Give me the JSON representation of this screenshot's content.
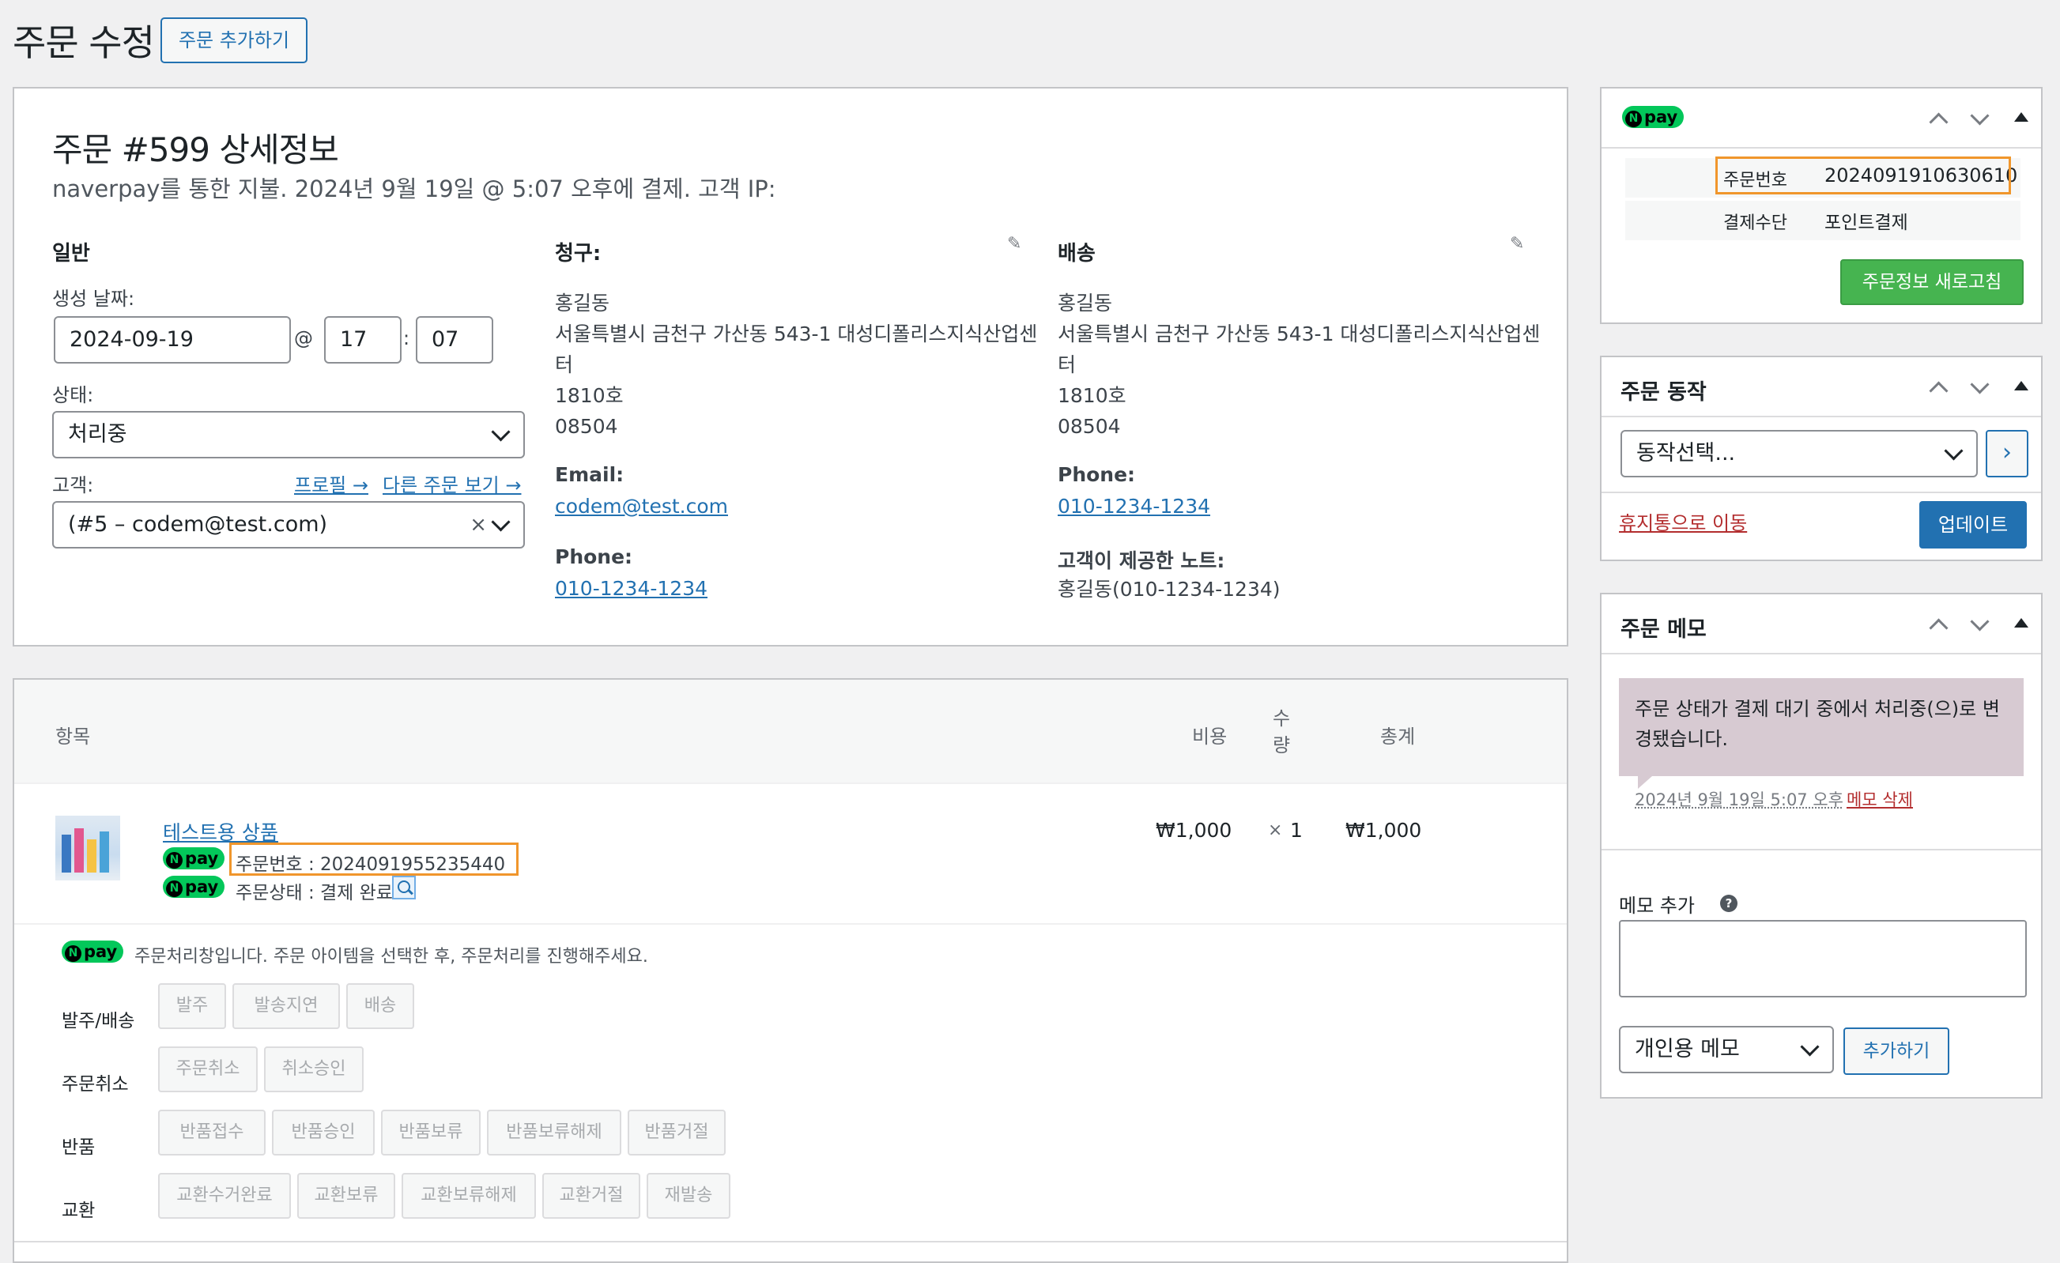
{
  "page": {
    "title": "주문 수정",
    "add_order": "주문 추가하기"
  },
  "order": {
    "heading": "주문 #599 상세정보",
    "subtitle": "naverpay를 통한 지불. 2024년 9월 19일 @ 5:07 오후에 결제. 고객 IP:",
    "general": {
      "title": "일반",
      "created_label": "생성 날짜:",
      "date": "2024-09-19",
      "at": "@",
      "hour": "17",
      "colon": ":",
      "minute": "07",
      "status_label": "상태:",
      "status": "처리중",
      "customer_label": "고객:",
      "profile_link": "프로필 →",
      "other_orders_link": "다른 주문 보기 →",
      "customer": "(#5 – codem@test.com)",
      "clear": "×"
    },
    "billing": {
      "title": "청구:",
      "name": "홍길동",
      "address1": "서울특별시 금천구 가산동 543-1 대성디폴리스지식산업센",
      "address2": "터",
      "unit": "1810호",
      "postcode": "08504",
      "email_label": "Email:",
      "email": "codem@test.com",
      "phone_label": "Phone:",
      "phone": "010-1234-1234"
    },
    "shipping": {
      "title": "배송",
      "name": "홍길동",
      "address1": "서울특별시 금천구 가산동 543-1 대성디폴리스지식산업센",
      "address2": "터",
      "unit": "1810호",
      "postcode": "08504",
      "phone_label": "Phone:",
      "phone": "010-1234-1234",
      "note_label": "고객이 제공한 노트:",
      "note": "홍길동(010-1234-1234)"
    }
  },
  "items": {
    "headers": {
      "item": "항목",
      "cost": "비용",
      "qty1": "수",
      "qty2": "량",
      "total": "총계"
    },
    "rows": [
      {
        "name": "테스트용 상품",
        "npay_order_no": "주문번호 : 2024091955235440",
        "npay_status": "주문상태 : 결제 완료",
        "cost": "₩1,000",
        "qty_x": "×",
        "qty": "1",
        "total": "₩1,000"
      }
    ],
    "npay_label": "pay",
    "npay_n": "N",
    "npay_notice": "주문처리창입니다. 주문 아이템을 선택한 후, 주문처리를 진행해주세요.",
    "groups": [
      {
        "label": "발주/배송",
        "buttons": [
          "발주",
          "발송지연",
          "배송"
        ]
      },
      {
        "label": "주문취소",
        "buttons": [
          "주문취소",
          "취소승인"
        ]
      },
      {
        "label": "반품",
        "buttons": [
          "반품접수",
          "반품승인",
          "반품보류",
          "반품보류해제",
          "반품거절"
        ]
      },
      {
        "label": "교환",
        "buttons": [
          "교환수거완료",
          "교환보류",
          "교환보류해제",
          "교환거절",
          "재발송"
        ]
      }
    ]
  },
  "sidebar": {
    "npay_box": {
      "order_no_label": "주문번호",
      "order_no": "2024091910630610",
      "payment_label": "결제수단",
      "payment": "포인트결제",
      "refresh_button": "주문정보 새로고침"
    },
    "actions": {
      "title": "주문 동작",
      "select": "동작선택...",
      "go": "›",
      "trash": "휴지통으로 이동",
      "update": "업데이트"
    },
    "notes": {
      "title": "주문 메모",
      "note_text_1": "주문 상태가 결제 대기 중에서 처리중(으)로 변",
      "note_text_2": "경됐습니다.",
      "note_meta": "2024년 9월 19일 5:07 오후",
      "delete": "메모 삭제",
      "add_label": "메모 추가",
      "help": "?",
      "type": "개인용 메모",
      "add_button": "추가하기"
    }
  },
  "colors": {
    "accent": "#2271b1",
    "npay_green": "#03c75a",
    "highlight": "#f0962c",
    "update": "#2271b1",
    "refresh": "#46b450",
    "trash": "#b32d2e",
    "note_bg": "#d7cad2"
  }
}
